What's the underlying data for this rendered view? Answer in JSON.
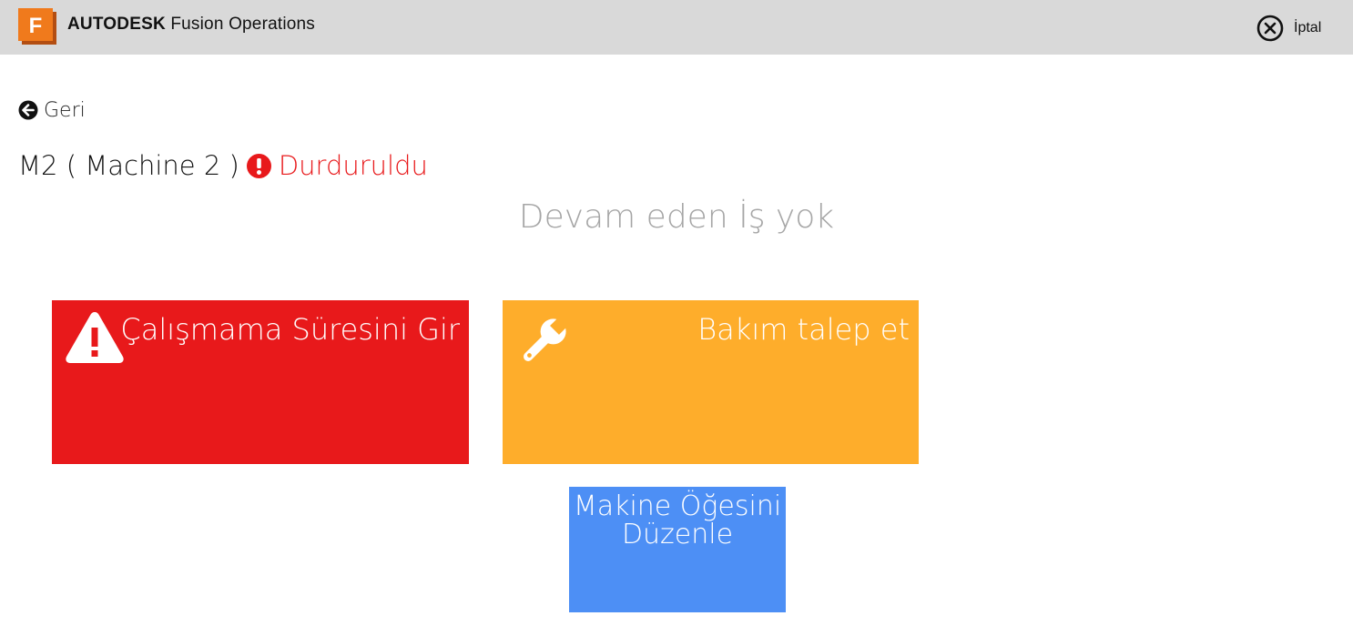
{
  "header": {
    "brand_bold": "AUTODESK",
    "brand_rest": "Fusion Operations",
    "logo_letter": "F",
    "logo_icon": "autodesk-fusion-logo-icon",
    "cancel_icon": "close-circle-icon",
    "cancel_label": "İptal"
  },
  "nav": {
    "back_icon": "arrow-left-circle-icon",
    "back_label": "Geri"
  },
  "machine": {
    "name": "M2 ( Machine 2 )",
    "status_icon": "exclamation-circle-icon",
    "status": "Durduruldu",
    "status_color": "#e8191b"
  },
  "job_message": "Devam eden İş yok",
  "tiles": [
    {
      "label": "Çalışmama Süresini Gir",
      "icon": "warning-triangle-icon",
      "color": "#e8191b"
    },
    {
      "label": "Bakım talep et",
      "icon": "wrench-icon",
      "color": "#fead2b"
    },
    {
      "label": "Makine Öğesini Düzenle",
      "icon": "",
      "color": "#4d8ff5"
    }
  ],
  "colors": {
    "topbar": "#d9d9d9",
    "logo_orange": "#f07a1c",
    "muted_text": "#a6a6a6"
  }
}
